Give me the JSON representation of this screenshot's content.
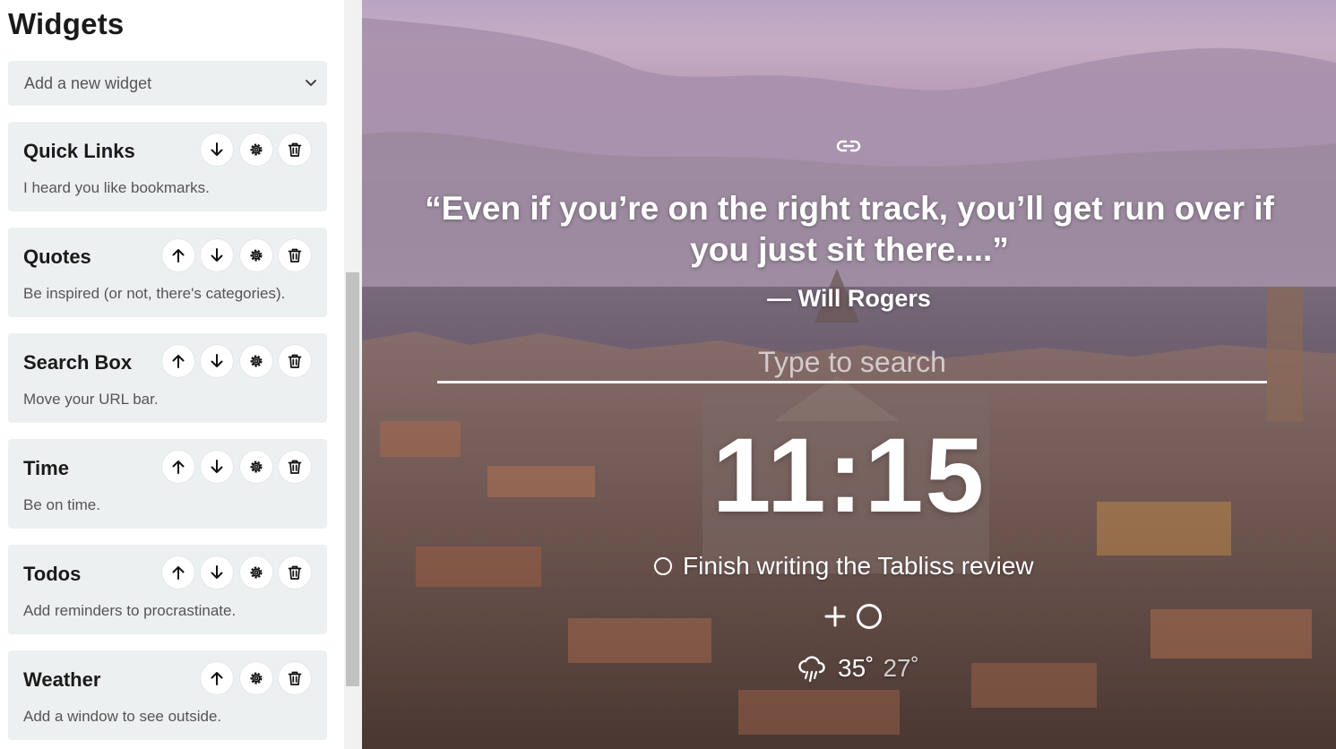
{
  "sidebar": {
    "title": "Widgets",
    "add_widget_placeholder": "Add a new widget",
    "widgets": [
      {
        "title": "Quick Links",
        "description": "I heard you like bookmarks."
      },
      {
        "title": "Quotes",
        "description": "Be inspired (or not, there's categories)."
      },
      {
        "title": "Search Box",
        "description": "Move your URL bar."
      },
      {
        "title": "Time",
        "description": "Be on time."
      },
      {
        "title": "Todos",
        "description": "Add reminders to procrastinate."
      },
      {
        "title": "Weather",
        "description": "Add a window to see outside."
      }
    ]
  },
  "dashboard": {
    "quote": "“Even if you’re on the right track, you’ll get run over if you just sit there....”",
    "author": "— Will Rogers",
    "search_placeholder": "Type to search",
    "time": "11:15",
    "todo": "Finish writing the Tabliss review",
    "weather": {
      "high": "35˚",
      "low": "27˚"
    }
  },
  "icons": [
    "link-icon",
    "arrow-up-icon",
    "arrow-down-icon",
    "gear-icon",
    "trash-icon",
    "chevron-down-icon",
    "plus-icon",
    "circle-icon",
    "rain-cloud-icon"
  ],
  "colors": {
    "sidebar_bg": "#ffffff",
    "card_bg": "#edf0f1",
    "text_dark": "#1a1a1a",
    "text_muted": "#555555",
    "overlay_text": "#ffffff"
  }
}
